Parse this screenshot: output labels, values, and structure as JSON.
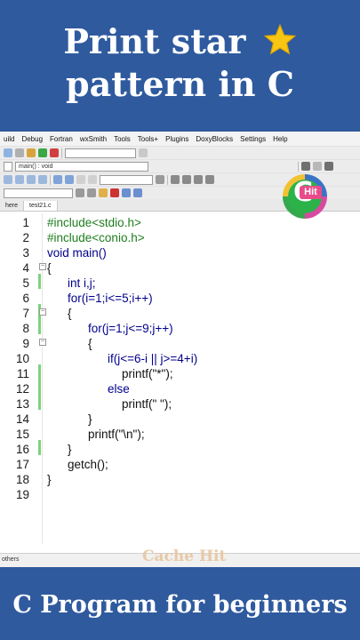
{
  "title": {
    "line1": "Print star",
    "line2": "pattern in C",
    "star_icon": "star-icon"
  },
  "menu": [
    "uild",
    "Debug",
    "Fortran",
    "wxSmith",
    "Tools",
    "Tools+",
    "Plugins",
    "DoxyBlocks",
    "Settings",
    "Help"
  ],
  "scope_combo": "main() : void",
  "tabs": [
    "here",
    "test21.c"
  ],
  "code_lines": [
    "#include<stdio.h>",
    "#include<conio.h>",
    "void main()",
    "{",
    "int i,j;",
    "for(i=1;i<=5;i++)",
    "{",
    "for(j=1;j<=9;j++)",
    "{",
    "if(j<=6-i || j>=4+i)",
    "printf(\"*\");",
    "else",
    "printf(\" \");",
    "}",
    "printf(\"\\n\");",
    "}",
    "getch();",
    "}",
    ""
  ],
  "line_numbers": [
    "1",
    "2",
    "3",
    "4",
    "5",
    "6",
    "7",
    "8",
    "9",
    "10",
    "11",
    "12",
    "13",
    "14",
    "15",
    "16",
    "17",
    "18",
    "19"
  ],
  "status": {
    "left": "others"
  },
  "watermark": "Cache Hit",
  "logo": {
    "letter": "C",
    "badge": "Hit"
  },
  "bottom_caption": "C Program for beginners",
  "colors": {
    "band": "#2f5a9e",
    "keyword": "#00008b",
    "preprocessor": "#1f7d1f",
    "string": "#7a1f1f"
  }
}
